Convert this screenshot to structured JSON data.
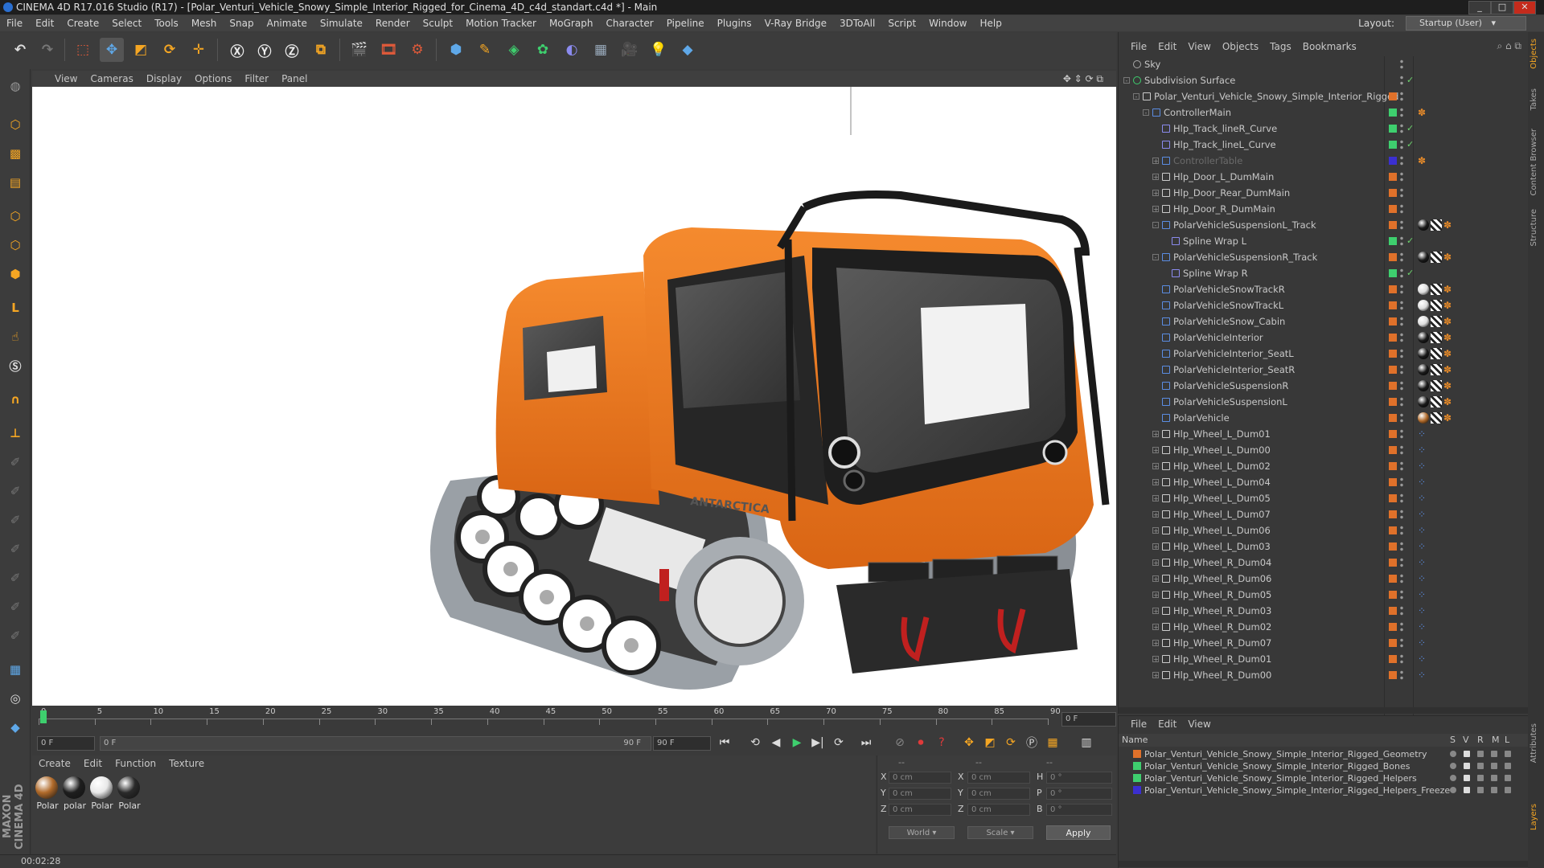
{
  "window": {
    "title": "CINEMA 4D R17.016 Studio (R17) - [Polar_Venturi_Vehicle_Snowy_Simple_Interior_Rigged_for_Cinema_4D_c4d_standart.c4d *] - Main",
    "min": "_",
    "max": "□",
    "close": "✕"
  },
  "menubar": {
    "items": [
      "File",
      "Edit",
      "Create",
      "Select",
      "Tools",
      "Mesh",
      "Snap",
      "Animate",
      "Simulate",
      "Render",
      "Sculpt",
      "Motion Tracker",
      "MoGraph",
      "Character",
      "Pipeline",
      "Plugins",
      "V-Ray Bridge",
      "3DToAll",
      "Script",
      "Window",
      "Help"
    ],
    "layout_label": "Layout:",
    "layout_value": "Startup (User)"
  },
  "viewport": {
    "menu": [
      "View",
      "Cameras",
      "Display",
      "Options",
      "Filter",
      "Panel"
    ],
    "decal_text": "ANTARCTICA"
  },
  "timeline": {
    "ticks": [
      "0",
      "5",
      "10",
      "15",
      "20",
      "25",
      "30",
      "35",
      "40",
      "45",
      "50",
      "55",
      "60",
      "65",
      "70",
      "75",
      "80",
      "85",
      "90"
    ],
    "frame_field": "0 F",
    "start_field": "0 F",
    "range_start": "0 F",
    "range_end": "90 F",
    "end_field": "90 F"
  },
  "materials": {
    "menu": [
      "Create",
      "Edit",
      "Function",
      "Texture"
    ],
    "items": [
      {
        "label": "Polar",
        "color": "#b06a2a"
      },
      {
        "label": "polar",
        "color": "#1e1e1e"
      },
      {
        "label": "Polar",
        "color": "#e8e8e8"
      },
      {
        "label": "Polar",
        "color": "#2a2a2a"
      }
    ]
  },
  "coordinates": {
    "header": [
      "--",
      "--",
      "--"
    ],
    "rows": [
      {
        "a": "X",
        "av": "0 cm",
        "b": "X",
        "bv": "0 cm",
        "c": "H",
        "cv": "0 °"
      },
      {
        "a": "Y",
        "av": "0 cm",
        "b": "Y",
        "bv": "0 cm",
        "c": "P",
        "cv": "0 °"
      },
      {
        "a": "Z",
        "av": "0 cm",
        "b": "Z",
        "bv": "0 cm",
        "c": "B",
        "cv": "0 °"
      }
    ],
    "mode": "World",
    "type": "Scale",
    "apply": "Apply"
  },
  "status": {
    "time": "00:02:28"
  },
  "object_manager": {
    "menu": [
      "File",
      "Edit",
      "View",
      "Objects",
      "Tags",
      "Bookmarks"
    ],
    "objects": [
      {
        "name": "Sky",
        "indent": 0,
        "fold": "",
        "icon": "sky",
        "layer": "",
        "tags": []
      },
      {
        "name": "Subdivision Surface",
        "indent": 0,
        "fold": "-",
        "icon": "subd",
        "layer": "",
        "tags": [],
        "check": true
      },
      {
        "name": "Polar_Venturi_Vehicle_Snowy_Simple_Interior_Rigged",
        "indent": 1,
        "fold": "-",
        "icon": "null",
        "layer": "#e0712a",
        "tags": []
      },
      {
        "name": "ControllerMain",
        "indent": 2,
        "fold": "-",
        "icon": "joint",
        "layer": "#3ecf6e",
        "tags": [
          "x"
        ]
      },
      {
        "name": "Hlp_Track_lineR_Curve",
        "indent": 3,
        "fold": "",
        "icon": "spline",
        "layer": "#3ecf6e",
        "tags": [],
        "check": true
      },
      {
        "name": "Hlp_Track_lineL_Curve",
        "indent": 3,
        "fold": "",
        "icon": "spline",
        "layer": "#3ecf6e",
        "tags": [],
        "check": true
      },
      {
        "name": "ControllerTable",
        "indent": 3,
        "fold": "+",
        "icon": "joint",
        "layer": "#3b2fd0",
        "tags": [
          "x"
        ],
        "dim": true
      },
      {
        "name": "Hlp_Door_L_DumMain",
        "indent": 3,
        "fold": "+",
        "icon": "null",
        "layer": "#e0712a",
        "tags": []
      },
      {
        "name": "Hlp_Door_Rear_DumMain",
        "indent": 3,
        "fold": "+",
        "icon": "null",
        "layer": "#e0712a",
        "tags": []
      },
      {
        "name": "Hlp_Door_R_DumMain",
        "indent": 3,
        "fold": "+",
        "icon": "null",
        "layer": "#e0712a",
        "tags": []
      },
      {
        "name": "PolarVehicleSuspensionL_Track",
        "indent": 3,
        "fold": "-",
        "icon": "poly",
        "layer": "#e0712a",
        "tags": [
          "dark",
          "chk",
          "x"
        ]
      },
      {
        "name": "Spline Wrap L",
        "indent": 4,
        "fold": "",
        "icon": "wrap",
        "layer": "#3ecf6e",
        "tags": [],
        "check": true
      },
      {
        "name": "PolarVehicleSuspensionR_Track",
        "indent": 3,
        "fold": "-",
        "icon": "poly",
        "layer": "#e0712a",
        "tags": [
          "dark",
          "chk",
          "x"
        ]
      },
      {
        "name": "Spline Wrap R",
        "indent": 4,
        "fold": "",
        "icon": "wrap",
        "layer": "#3ecf6e",
        "tags": [],
        "check": true
      },
      {
        "name": "PolarVehicleSnowTrackR",
        "indent": 3,
        "fold": "",
        "icon": "poly",
        "layer": "#e0712a",
        "tags": [
          "white",
          "chk",
          "x"
        ]
      },
      {
        "name": "PolarVehicleSnowTrackL",
        "indent": 3,
        "fold": "",
        "icon": "poly",
        "layer": "#e0712a",
        "tags": [
          "white",
          "chk",
          "x"
        ]
      },
      {
        "name": "PolarVehicleSnow_Cabin",
        "indent": 3,
        "fold": "",
        "icon": "poly",
        "layer": "#e0712a",
        "tags": [
          "white",
          "chk",
          "x"
        ]
      },
      {
        "name": "PolarVehicleInterior",
        "indent": 3,
        "fold": "",
        "icon": "poly",
        "layer": "#e0712a",
        "tags": [
          "dark",
          "chk",
          "x"
        ]
      },
      {
        "name": "PolarVehicleInterior_SeatL",
        "indent": 3,
        "fold": "",
        "icon": "poly",
        "layer": "#e0712a",
        "tags": [
          "dark",
          "chk",
          "x"
        ]
      },
      {
        "name": "PolarVehicleInterior_SeatR",
        "indent": 3,
        "fold": "",
        "icon": "poly",
        "layer": "#e0712a",
        "tags": [
          "dark",
          "chk",
          "x"
        ]
      },
      {
        "name": "PolarVehicleSuspensionR",
        "indent": 3,
        "fold": "",
        "icon": "poly",
        "layer": "#e0712a",
        "tags": [
          "dark",
          "chk",
          "x"
        ]
      },
      {
        "name": "PolarVehicleSuspensionL",
        "indent": 3,
        "fold": "",
        "icon": "poly",
        "layer": "#e0712a",
        "tags": [
          "dark",
          "chk",
          "x"
        ]
      },
      {
        "name": "PolarVehicle",
        "indent": 3,
        "fold": "",
        "icon": "poly",
        "layer": "#e0712a",
        "tags": [
          "orange",
          "chk",
          "x"
        ]
      },
      {
        "name": "Hlp_Wheel_L_Dum01",
        "indent": 3,
        "fold": "+",
        "icon": "null",
        "layer": "#e0712a",
        "tags": [
          "dot"
        ]
      },
      {
        "name": "Hlp_Wheel_L_Dum00",
        "indent": 3,
        "fold": "+",
        "icon": "null",
        "layer": "#e0712a",
        "tags": [
          "dot"
        ]
      },
      {
        "name": "Hlp_Wheel_L_Dum02",
        "indent": 3,
        "fold": "+",
        "icon": "null",
        "layer": "#e0712a",
        "tags": [
          "dot"
        ]
      },
      {
        "name": "Hlp_Wheel_L_Dum04",
        "indent": 3,
        "fold": "+",
        "icon": "null",
        "layer": "#e0712a",
        "tags": [
          "dot"
        ]
      },
      {
        "name": "Hlp_Wheel_L_Dum05",
        "indent": 3,
        "fold": "+",
        "icon": "null",
        "layer": "#e0712a",
        "tags": [
          "dot"
        ]
      },
      {
        "name": "Hlp_Wheel_L_Dum07",
        "indent": 3,
        "fold": "+",
        "icon": "null",
        "layer": "#e0712a",
        "tags": [
          "dot"
        ]
      },
      {
        "name": "Hlp_Wheel_L_Dum06",
        "indent": 3,
        "fold": "+",
        "icon": "null",
        "layer": "#e0712a",
        "tags": [
          "dot"
        ]
      },
      {
        "name": "Hlp_Wheel_L_Dum03",
        "indent": 3,
        "fold": "+",
        "icon": "null",
        "layer": "#e0712a",
        "tags": [
          "dot"
        ]
      },
      {
        "name": "Hlp_Wheel_R_Dum04",
        "indent": 3,
        "fold": "+",
        "icon": "null",
        "layer": "#e0712a",
        "tags": [
          "dot"
        ]
      },
      {
        "name": "Hlp_Wheel_R_Dum06",
        "indent": 3,
        "fold": "+",
        "icon": "null",
        "layer": "#e0712a",
        "tags": [
          "dot"
        ]
      },
      {
        "name": "Hlp_Wheel_R_Dum05",
        "indent": 3,
        "fold": "+",
        "icon": "null",
        "layer": "#e0712a",
        "tags": [
          "dot"
        ]
      },
      {
        "name": "Hlp_Wheel_R_Dum03",
        "indent": 3,
        "fold": "+",
        "icon": "null",
        "layer": "#e0712a",
        "tags": [
          "dot"
        ]
      },
      {
        "name": "Hlp_Wheel_R_Dum02",
        "indent": 3,
        "fold": "+",
        "icon": "null",
        "layer": "#e0712a",
        "tags": [
          "dot"
        ]
      },
      {
        "name": "Hlp_Wheel_R_Dum07",
        "indent": 3,
        "fold": "+",
        "icon": "null",
        "layer": "#e0712a",
        "tags": [
          "dot"
        ]
      },
      {
        "name": "Hlp_Wheel_R_Dum01",
        "indent": 3,
        "fold": "+",
        "icon": "null",
        "layer": "#e0712a",
        "tags": [
          "dot"
        ]
      },
      {
        "name": "Hlp_Wheel_R_Dum00",
        "indent": 3,
        "fold": "+",
        "icon": "null",
        "layer": "#e0712a",
        "tags": [
          "dot"
        ]
      }
    ]
  },
  "side_tabs": [
    "Objects",
    "Takes",
    "Content Browser",
    "Structure",
    "Attributes",
    "Layers"
  ],
  "layer_manager": {
    "menu": [
      "File",
      "Edit",
      "View"
    ],
    "columns": {
      "name": "Name",
      "s": "S",
      "v": "V",
      "r": "R",
      "m": "M",
      "l": "L"
    },
    "layers": [
      {
        "name": "Polar_Venturi_Vehicle_Snowy_Simple_Interior_Rigged_Geometry",
        "color": "#e0712a"
      },
      {
        "name": "Polar_Venturi_Vehicle_Snowy_Simple_Interior_Rigged_Bones",
        "color": "#3ecf6e"
      },
      {
        "name": "Polar_Venturi_Vehicle_Snowy_Simple_Interior_Rigged_Helpers",
        "color": "#3ecf6e"
      },
      {
        "name": "Polar_Venturi_Vehicle_Snowy_Simple_Interior_Rigged_Helpers_Freeze",
        "color": "#3b2fd0"
      }
    ]
  },
  "colors": {
    "accent_orange": "#f5a623",
    "vehicle_orange": "#f07a1e",
    "play_green": "#3ecf6e"
  }
}
